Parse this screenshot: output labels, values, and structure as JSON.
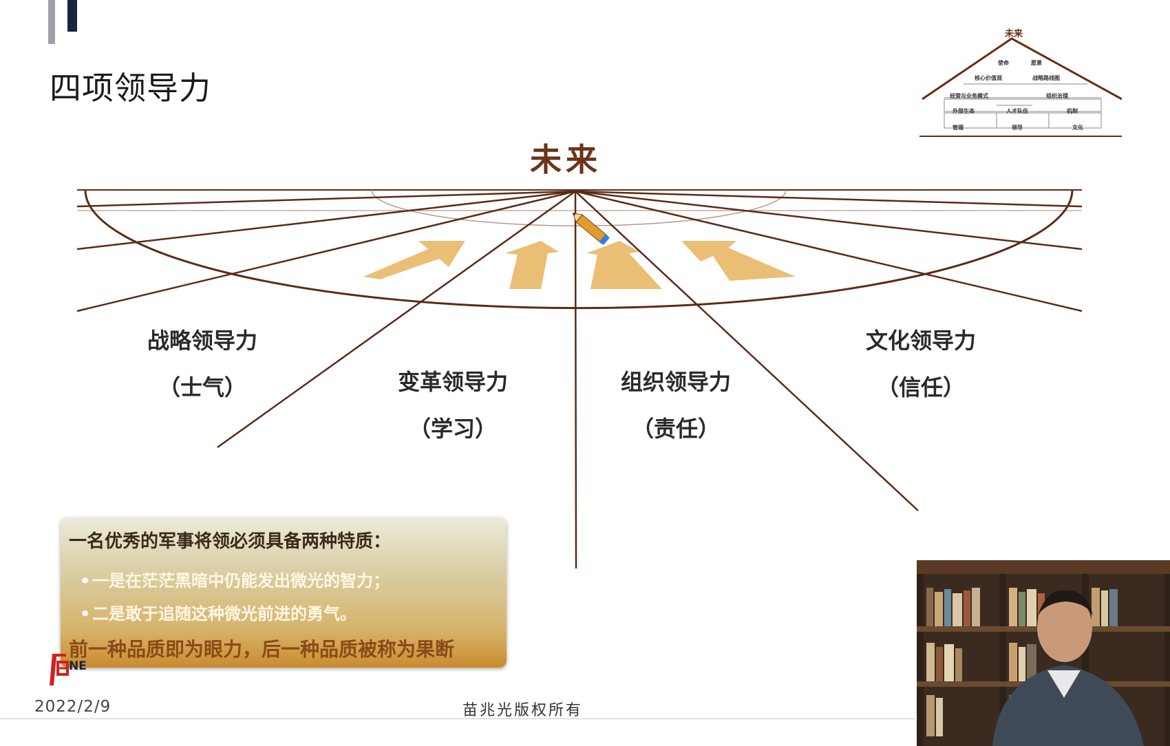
{
  "slide": {
    "title": "四项领导力",
    "future_label": "未来",
    "diagram": {
      "leaderships": [
        {
          "name": "战略领导力",
          "value": "（士气）"
        },
        {
          "name": "变革领导力",
          "value": "（学习）"
        },
        {
          "name": "组织领导力",
          "value": "（责任）"
        },
        {
          "name": "文化领导力",
          "value": "（信任）"
        }
      ]
    },
    "house_thumbnail": {
      "roof": "未来",
      "row1": [
        "使命",
        "愿景"
      ],
      "row2": [
        "核心价值观",
        "战略路线图"
      ],
      "row3": [
        "经营与业务模式",
        "组织治理"
      ],
      "row4": [
        "外部生态",
        "人才队伍",
        "机制"
      ],
      "row5": [
        "管理",
        "领导",
        "文化"
      ]
    },
    "quote": {
      "heading": "一名优秀的军事将领必须具备两种特质：",
      "bullets": [
        "一是在茫茫黑暗中仍能发出微光的智力；",
        "二是敢于追随这种微光前进的勇气。"
      ],
      "conclusion": "前一种品质即为眼力，后一种品质被称为果断",
      "bullet_symbol": "•"
    },
    "logo_text": "NE",
    "date": "2022/2/9",
    "copyright": "苗兆光版权所有"
  },
  "colors": {
    "line_brown": "#5c2a16",
    "arrow_gold": "#e8b866",
    "title_dark": "#1a1a1a",
    "future_brown": "#6b3318"
  },
  "icons": {
    "pencil": "pencil-icon",
    "logo": "brand-logo"
  }
}
